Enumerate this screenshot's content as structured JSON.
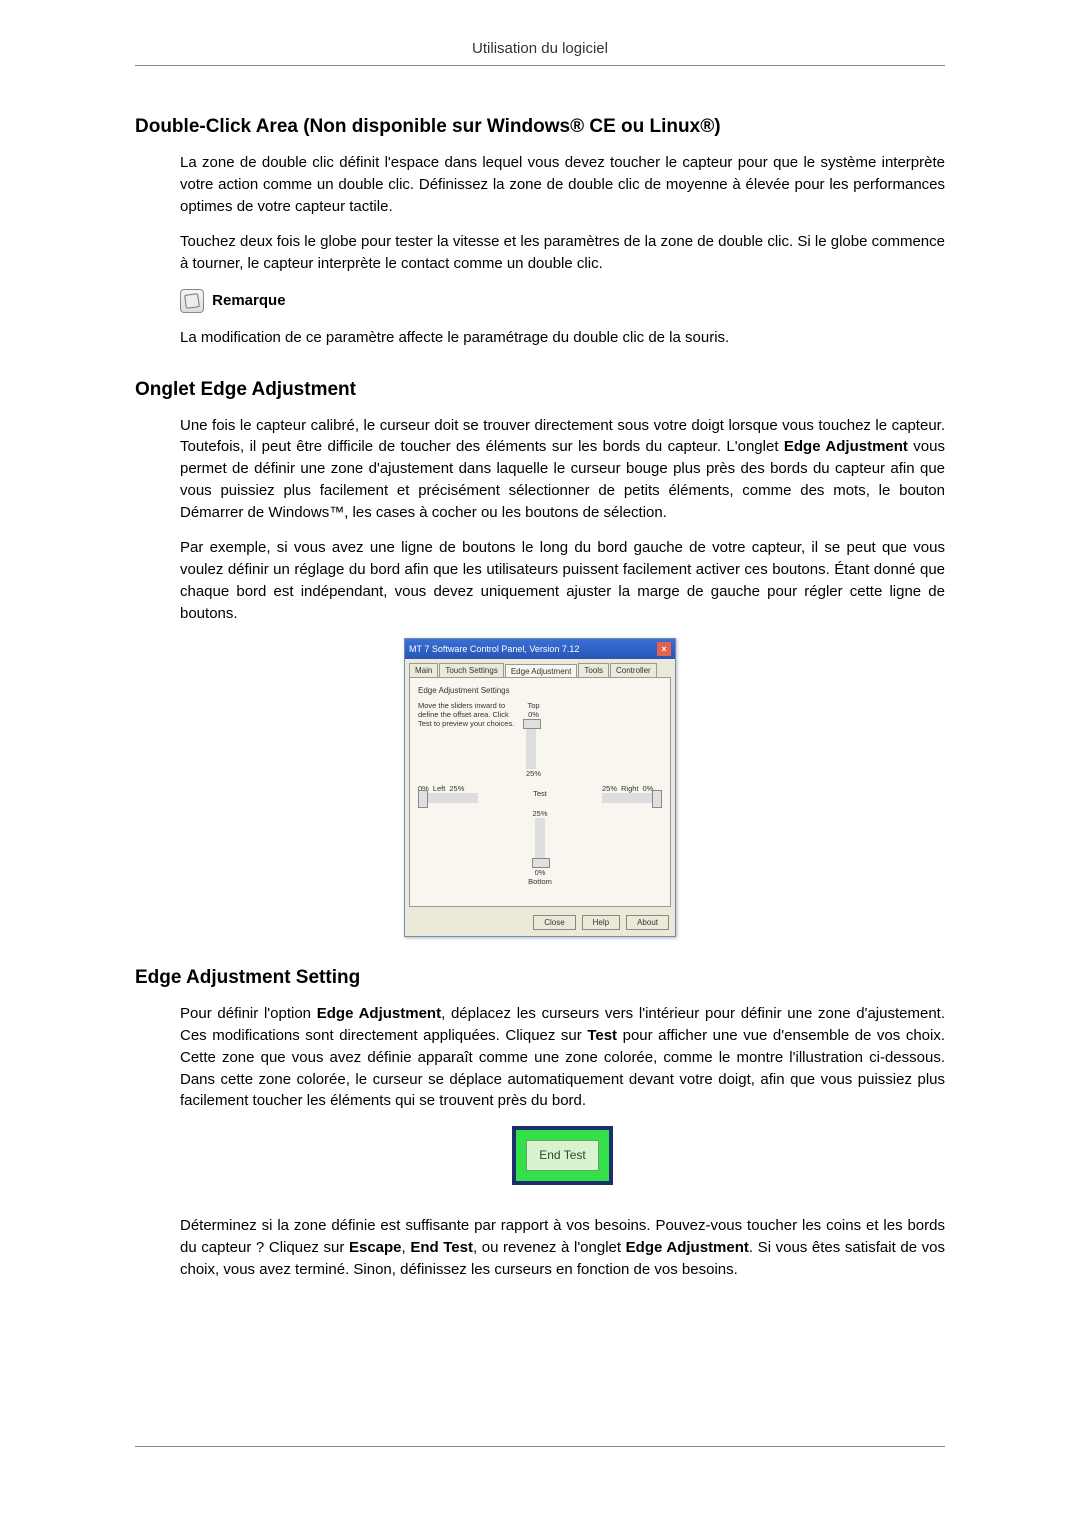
{
  "header": {
    "title": "Utilisation du logiciel"
  },
  "section1": {
    "heading": "Double-Click Area (Non disponible sur Windows® CE ou Linux®)",
    "p1": "La zone de double clic définit l'espace dans lequel vous devez toucher le capteur pour que le système interprète votre action comme un double clic. Définissez la zone de double clic de moyenne à élevée pour les performances optimes de votre capteur tactile.",
    "p2": "Touchez deux fois le globe pour tester la vitesse et les paramètres de la zone de double clic. Si le globe commence à tourner, le capteur interprète le contact comme un double clic.",
    "note_label": "Remarque",
    "p3": "La modification de ce paramètre affecte le paramétrage du double clic de la souris."
  },
  "section2": {
    "heading": "Onglet Edge Adjustment",
    "p1a": "Une fois le capteur calibré, le curseur doit se trouver directement sous votre doigt lorsque vous touchez le capteur. Toutefois, il peut être difficile de toucher des éléments sur les bords du capteur. L'onglet ",
    "p1b_bold": "Edge Adjustment",
    "p1c": " vous permet de définir une zone d'ajustement dans laquelle le curseur bouge plus près des bords du capteur afin que vous puissiez plus facilement et précisément sélectionner de petits éléments, comme des mots, le bouton Démarrer de Windows™, les cases à cocher ou les boutons de sélection.",
    "p2": "Par exemple, si vous avez une ligne de boutons le long du bord gauche de votre capteur, il se peut que vous voulez définir un réglage du bord afin que les utilisateurs puissent facilement activer ces boutons. Étant donné que chaque bord est indépendant, vous devez uniquement ajuster la marge de gauche pour régler cette ligne de boutons."
  },
  "control_panel": {
    "title": "MT 7 Software Control Panel, Version 7.12",
    "tabs": [
      "Main",
      "Touch Settings",
      "Edge Adjustment",
      "Tools",
      "Controller"
    ],
    "group_label": "Edge Adjustment Settings",
    "instructions": "Move the sliders inward to define the offset area. Click Test to preview your choices.",
    "top_label": "Top",
    "bottom_label": "Bottom",
    "left_label": "Left",
    "right_label": "Right",
    "test_label": "Test",
    "pct0": "0%",
    "pct25": "25%",
    "buttons": {
      "close": "Close",
      "help": "Help",
      "about": "About"
    }
  },
  "section3": {
    "heading": "Edge Adjustment Setting",
    "p1a": "Pour définir l'option ",
    "p1b_bold": "Edge Adjustment",
    "p1c": ", déplacez les curseurs vers l'intérieur pour définir une zone d'ajustement. Ces modifications sont directement appliquées. Cliquez sur ",
    "p1d_bold": "Test",
    "p1e": " pour afficher une vue d'ensemble de vos choix. Cette zone que vous avez définie apparaît comme une zone colorée, comme le montre l'illustration ci-dessous. Dans cette zone colorée, le curseur se déplace automatiquement devant votre doigt, afin que vous puissiez plus facilement toucher les éléments qui se trouvent près du bord.",
    "end_test_label": "End Test",
    "p2a": "Déterminez si la zone définie est suffisante par rapport à vos besoins. Pouvez-vous toucher les coins et les bords du capteur ? Cliquez sur ",
    "p2b_bold": "Escape",
    "p2c": ", ",
    "p2d_bold": "End Test",
    "p2e": ", ou revenez à l'onglet ",
    "p2f_bold": "Edge Adjustment",
    "p2g": ". Si vous êtes satisfait de vos choix, vous avez terminé. Sinon, définissez les curseurs en fonction de vos besoins."
  }
}
